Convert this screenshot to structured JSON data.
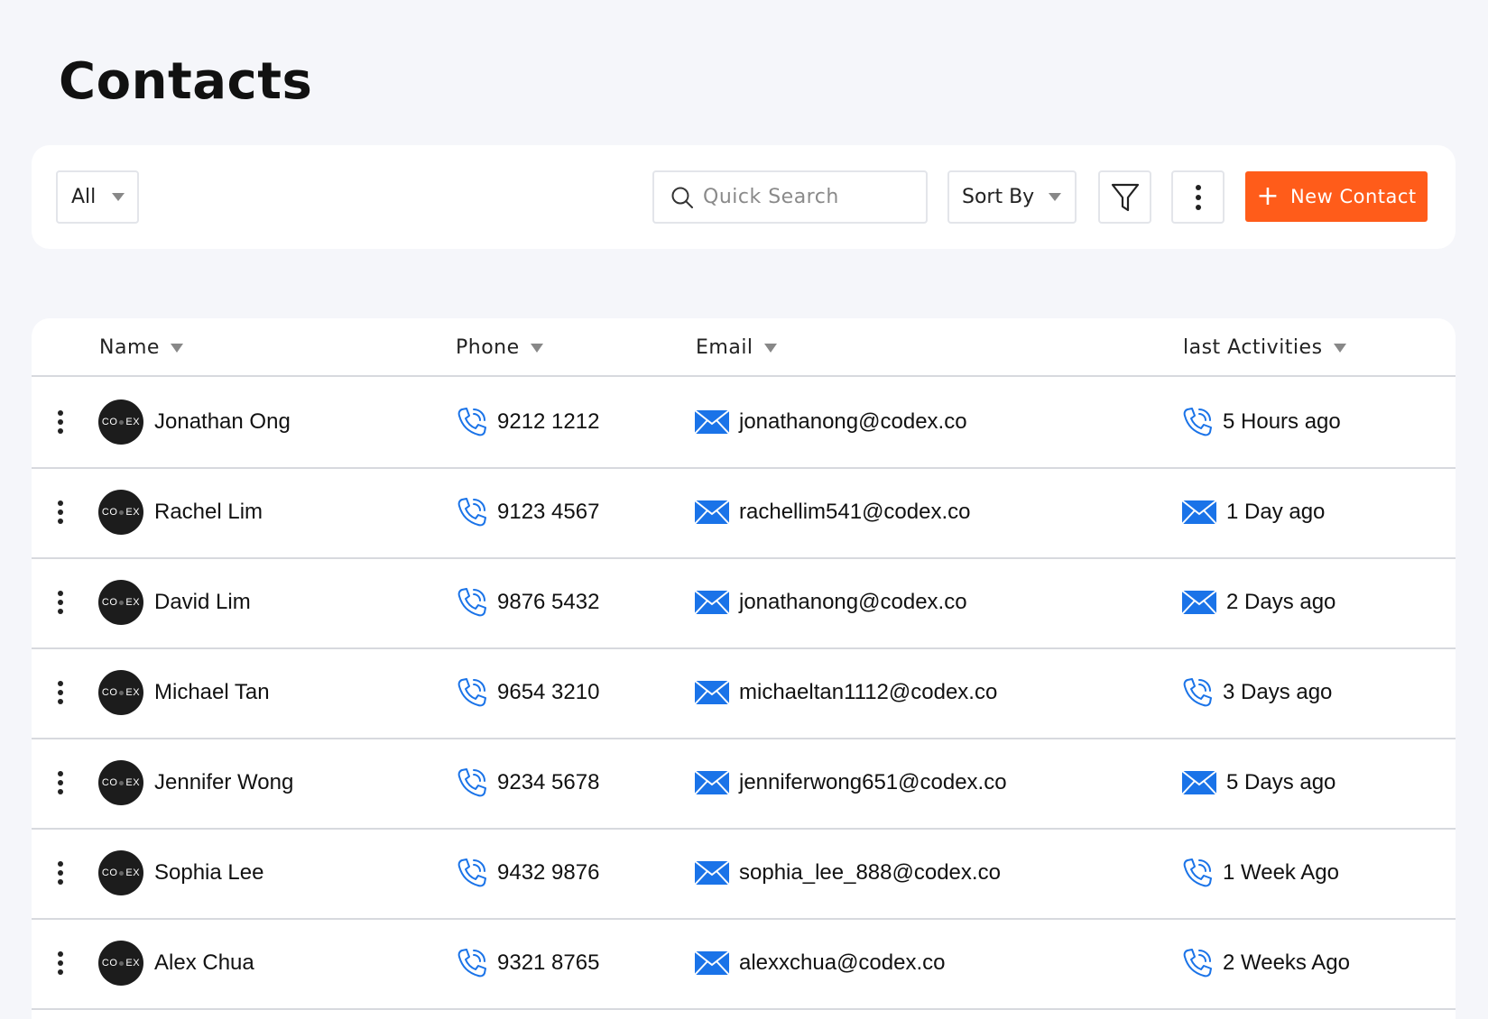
{
  "page": {
    "title": "Contacts"
  },
  "toolbar": {
    "filter_value": "All",
    "search_placeholder": "Quick Search",
    "sort_label": "Sort By",
    "new_contact_label": "New Contact"
  },
  "colors": {
    "accent": "#ff5c1a",
    "icon_blue": "#1a73e8",
    "avatar_bg": "#1c1c1c"
  },
  "avatar_logo": {
    "left": "CO",
    "right": "EX"
  },
  "table": {
    "columns": [
      "Name",
      "Phone",
      "Email",
      "last Activities"
    ],
    "rows": [
      {
        "name": "Jonathan Ong",
        "phone": "9212 1212",
        "email": "jonathanong@codex.co",
        "activity": "5 Hours ago",
        "activity_icon": "phone-icon"
      },
      {
        "name": "Rachel Lim",
        "phone": "9123 4567",
        "email": "rachellim541@codex.co",
        "activity": "1 Day ago",
        "activity_icon": "mail-icon"
      },
      {
        "name": "David Lim",
        "phone": "9876 5432",
        "email": "jonathanong@codex.co",
        "activity": "2 Days ago",
        "activity_icon": "mail-icon"
      },
      {
        "name": "Michael Tan",
        "phone": "9654 3210",
        "email": "michaeltan1112@codex.co",
        "activity": "3 Days ago",
        "activity_icon": "phone-icon"
      },
      {
        "name": "Jennifer Wong",
        "phone": "9234 5678",
        "email": "jenniferwong651@codex.co",
        "activity": "5 Days ago",
        "activity_icon": "mail-icon"
      },
      {
        "name": "Sophia Lee",
        "phone": "9432 9876",
        "email": "sophia_lee_888@codex.co",
        "activity": "1 Week Ago",
        "activity_icon": "phone-icon"
      },
      {
        "name": "Alex Chua",
        "phone": "9321 8765",
        "email": "alexxchua@codex.co",
        "activity": "2 Weeks Ago",
        "activity_icon": "phone-icon"
      }
    ]
  }
}
